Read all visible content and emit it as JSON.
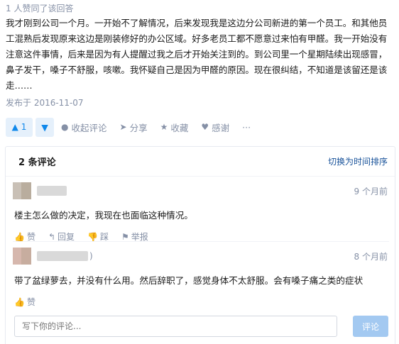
{
  "answer": {
    "upvote_note": "1 人赞同了该回答",
    "text": "我才刚到公司一个月。一开始不了解情况，后来发现我是这边分公司新进的第一个员工。和其他员工混熟后发现原来这边是刚装修好的办公区域。好多老员工都不愿意过来怕有甲醛。我一开始没有注意这件事情，后来是因为有人提醒过我之后才开始关注到的。到公司里一个星期陆续出现感冒，鼻子发干，嗓子不舒服，咳嗽。我怀疑自己是因为甲醛的原因。现在很纠结，不知道是该留还是该走……",
    "published": "发布于 2016-11-07"
  },
  "actions": {
    "upvote_count": "1",
    "collapse_comments": "收起评论",
    "share": "分享",
    "favorite": "收藏",
    "thanks": "感谢",
    "more": "···"
  },
  "comments_section": {
    "count_label": "2 条评论",
    "sort_toggle": "切换为时间排序",
    "items": [
      {
        "time": "9 个月前",
        "text": "楼主怎么做的决定，我现在也面临这种情况。",
        "like": "赞",
        "reply": "回复",
        "dislike": "踩",
        "report": "举报"
      },
      {
        "time": "8 个月前",
        "name_suffix": ")",
        "text": "带了盆绿萝去，并没有什么用。然后辞职了，感觉身体不太舒服。会有嗓子痛之类的症状",
        "like": "赞"
      }
    ],
    "input_placeholder": "写下你的评论...",
    "submit": "评论"
  }
}
